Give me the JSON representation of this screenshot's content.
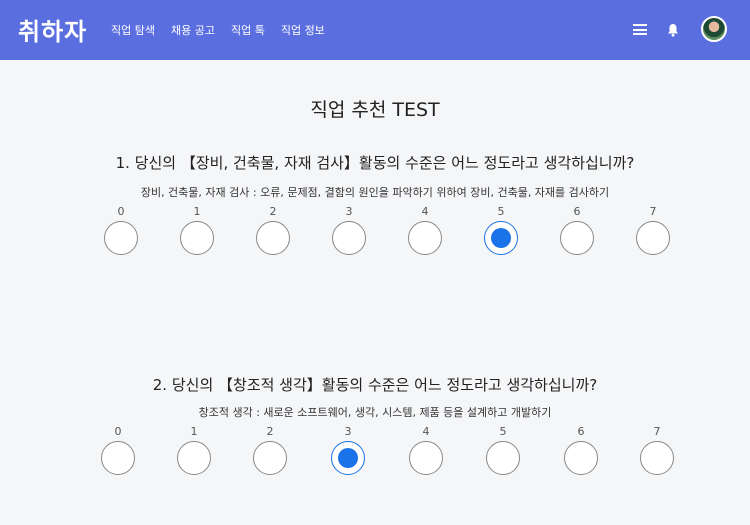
{
  "navbar": {
    "logo": "취하자",
    "links": [
      "직업 탐색",
      "채용 공고",
      "직업 톡",
      "직업 정보"
    ],
    "accent_color": "#5a6ee0"
  },
  "page": {
    "title": "직업 추천 TEST"
  },
  "questions": [
    {
      "title": "1. 당신의 【장비, 건축물, 자재 검사】활동의 수준은 어느 정도라고 생각하십니까?",
      "description": "장비, 건축물, 자재 검사 : 오류, 문제점, 결함의 원인을 파악하기 위하여 장비, 건축물, 자재를 검사하기",
      "options": [
        "0",
        "1",
        "2",
        "3",
        "4",
        "5",
        "6",
        "7"
      ],
      "selected": "5"
    },
    {
      "title": "2. 당신의 【창조적 생각】활동의 수준은 어느 정도라고 생각하십니까?",
      "description": "창조적 생각 : 새로운 소프트웨어, 생각, 시스템, 제품 등을 설계하고 개발하기",
      "options": [
        "0",
        "1",
        "2",
        "3",
        "4",
        "5",
        "6",
        "7"
      ],
      "selected": "3"
    }
  ],
  "selected_color": "#1a73e8"
}
